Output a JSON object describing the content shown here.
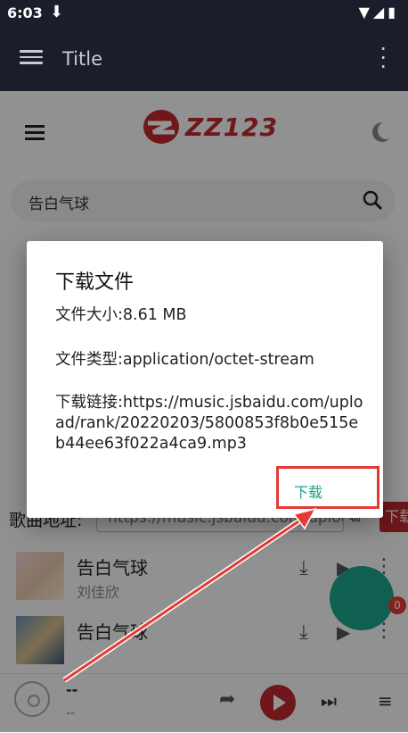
{
  "status_bar": {
    "time": "6:03",
    "download_icon": "download-icon",
    "right_icons": "signal wifi battery"
  },
  "app_bar": {
    "title": "Title"
  },
  "page": {
    "logo_text": "ZZ123",
    "search": {
      "query": "告白气球"
    },
    "lyric_label": "歌曲地址:",
    "lyric_url": "https://music.jsbaidu.com/upload/rank/...",
    "copy_button": "下载",
    "songs": [
      {
        "title": "告白气球",
        "artist": "刘佳欣"
      },
      {
        "title": "告白气球",
        "artist": ""
      }
    ]
  },
  "player": {
    "title": "--",
    "artist": "--",
    "queue_count": "0"
  },
  "dialog": {
    "title": "下载文件",
    "file_size": "文件大小:8.61 MB",
    "file_type": "文件类型:application/octet-stream",
    "download_link": "下载链接:https://music.jsbaidu.com/upload/rank/20220203/5800853f8b0e515eb44ee63f022a4ca9.mp3",
    "download_button": "下载"
  },
  "colors": {
    "brand_red": "#c0282e",
    "accent_teal": "#1aa68c",
    "annotation_red": "#e53935"
  }
}
